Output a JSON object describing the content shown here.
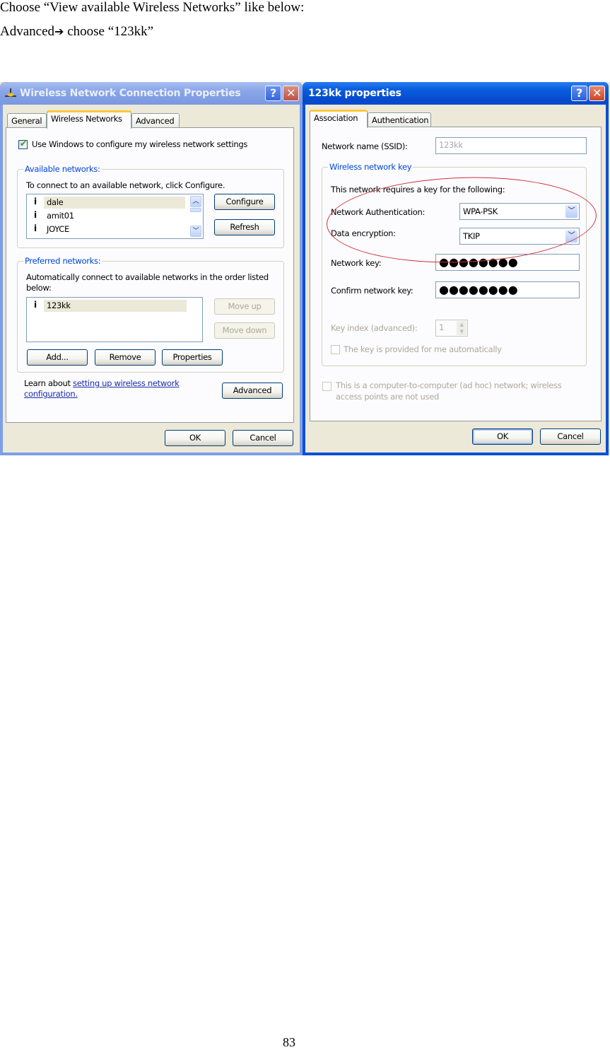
{
  "document": {
    "line1": "Choose “View available Wireless Networks” like below:",
    "line2_prefix": "Advanced",
    "line2_arrow": "➔",
    "line2_suffix": " choose “123kk”",
    "page_number": "83"
  },
  "left_window": {
    "title": "Wireless Network Connection Properties",
    "title_icon": "network-connection-icon",
    "state": "inactive",
    "help_label": "?",
    "close_label": "✕",
    "tabs": [
      {
        "label": "General",
        "active": false
      },
      {
        "label": "Wireless Networks",
        "active": true
      },
      {
        "label": "Advanced",
        "active": false
      }
    ],
    "use_windows_checkbox": {
      "label": "Use Windows to configure my wireless network settings",
      "checked": true
    },
    "available_networks": {
      "group_label": "Available networks:",
      "description": "To connect to an available network, click Configure.",
      "items": [
        {
          "name": "dale",
          "selected": true
        },
        {
          "name": "amit01",
          "selected": false
        },
        {
          "name": "JOYCE",
          "selected": false
        }
      ],
      "configure_button": "Configure",
      "refresh_button": "Refresh"
    },
    "preferred_networks": {
      "group_label": "Preferred networks:",
      "description_line1": "Automatically connect to available networks in the order listed",
      "description_line2": "below:",
      "items": [
        {
          "name": "123kk",
          "selected": true
        }
      ],
      "move_up_button": "Move up",
      "move_down_button": "Move down",
      "add_button": "Add...",
      "remove_button": "Remove",
      "properties_button": "Properties"
    },
    "learn_prefix": "Learn about ",
    "learn_link_line1": "setting up wireless network",
    "learn_link_line2": "configuration.",
    "advanced_button": "Advanced",
    "ok_button": "OK",
    "cancel_button": "Cancel"
  },
  "right_window": {
    "title": "123kk properties",
    "state": "active",
    "help_label": "?",
    "close_label": "✕",
    "tabs": [
      {
        "label": "Association",
        "active": true
      },
      {
        "label": "Authentication",
        "active": false
      }
    ],
    "ssid_label": "Network name (SSID):",
    "ssid_value": "123kk",
    "key_group_label": "Wireless network key",
    "key_description": "This network requires a key for the following:",
    "auth_label": "Network Authentication:",
    "auth_value": "WPA-PSK",
    "encryption_label": "Data encryption:",
    "encryption_value": "TKIP",
    "network_key_label": "Network key:",
    "network_key_value": "●●●●●●●●",
    "confirm_key_label": "Confirm network key:",
    "confirm_key_value": "●●●●●●●●",
    "key_index_label": "Key index (advanced):",
    "key_index_value": "1",
    "auto_key_checkbox": {
      "label": "The key is provided for me automatically",
      "checked": false,
      "enabled": false
    },
    "adhoc_checkbox": {
      "label_line1": "This is a computer-to-computer (ad hoc) network; wireless",
      "label_line2": "access points are not used",
      "checked": false,
      "enabled": false
    },
    "ok_button": "OK",
    "cancel_button": "Cancel"
  },
  "annotation": {
    "shape": "ellipse",
    "color": "#d0303a",
    "highlights": "Network Authentication and Data encryption settings"
  },
  "colors": {
    "active_titlebar": "#0a50d8",
    "inactive_titlebar": "#7e9ee8",
    "dialog_bg": "#ece9d8",
    "group_label": "#0046d5",
    "tab_highlight": "#ffc83c"
  }
}
